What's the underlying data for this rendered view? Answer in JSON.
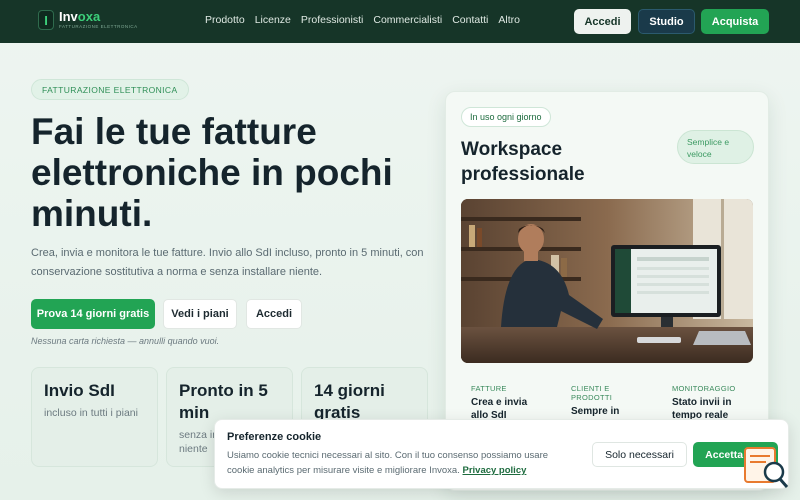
{
  "brand": {
    "name_prefix": "Inv",
    "name_suffix": "oxa",
    "tagline": "FATTURAZIONE ELETTRONICA",
    "mark": "I"
  },
  "nav": {
    "items": [
      "Prodotto",
      "Licenze",
      "Professionisti",
      "Commercialisti",
      "Contatti",
      "Altro"
    ],
    "accedi": "Accedi",
    "studio": "Studio",
    "acquista": "Acquista"
  },
  "hero": {
    "badge": "FATTURAZIONE ELETTRONICA",
    "title": "Fai le tue fatture elettroniche in pochi minuti.",
    "subtitle": "Crea, invia e monitora le tue fatture. Invio allo SdI incluso, pronto in 5 minuti, con conservazione sostitutiva a norma e senza installare niente.",
    "cta_trial": "Prova 14 giorni gratis",
    "cta_plans": "Vedi i piani",
    "cta_login": "Accedi",
    "note": "Nessuna carta richiesta — annulli quando vuoi."
  },
  "stats": [
    {
      "title": "Invio SdI",
      "text": "incluso in tutti i piani"
    },
    {
      "title": "Pronto in 5 min",
      "text": "senza installare niente"
    },
    {
      "title": "14 giorni gratis",
      "text": ""
    }
  ],
  "card": {
    "chip": "In uso ogni giorno",
    "title": "Workspace professionale",
    "pill": "Semplice e veloce",
    "features": [
      {
        "key": "FATTURE",
        "value": "Crea e invia allo SdI"
      },
      {
        "key": "CLIENTI E PRODOTTI",
        "value": "Sempre in ordine"
      },
      {
        "key": "MONITORAGGIO",
        "value": "Stato invii in tempo reale"
      }
    ]
  },
  "cookie": {
    "title": "Preferenze cookie",
    "text": "Usiamo cookie tecnici necessari al sito. Con il tuo consenso possiamo usare cookie analytics per misurare visite e migliorare Invoxa.",
    "link": "Privacy policy",
    "btn_necessary": "Solo necessari",
    "btn_accept": "Accetta tutti"
  },
  "colors": {
    "nav_bg": "#163528",
    "accent": "#22a454",
    "studio": "#1a3a4a"
  },
  "icons": {
    "widget": "magnifier-document-icon"
  }
}
